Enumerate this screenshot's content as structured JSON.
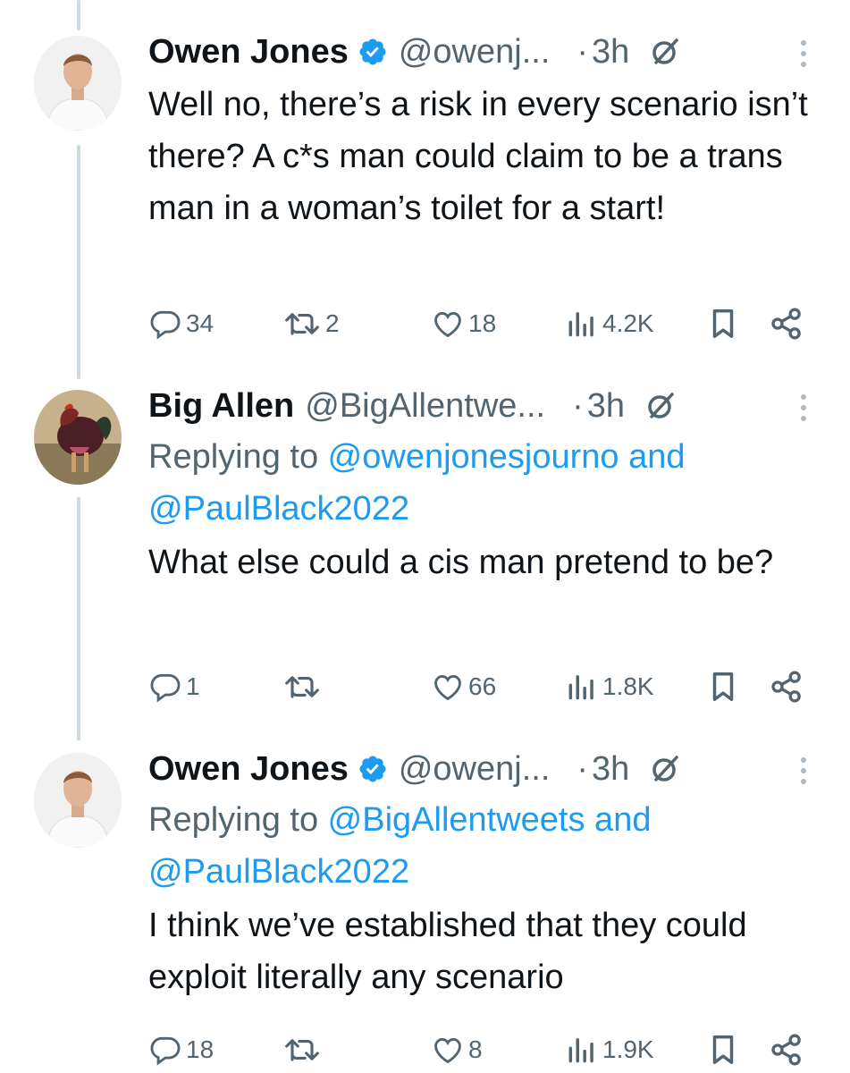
{
  "tweets": [
    {
      "author": "Owen Jones",
      "verified": true,
      "handle": "@owenj...",
      "dot": "·",
      "time": "3h",
      "reply_prefix": "",
      "reply_link1": "",
      "reply_and": "",
      "reply_link2": "",
      "text": "Well no, there’s a risk in every scenario isn’t there? A c*s man could claim to be a trans man in a woman’s toilet for a start!",
      "replies": "34",
      "retweets": "2",
      "likes": "18",
      "views": "4.2K"
    },
    {
      "author": "Big Allen",
      "verified": false,
      "handle": "@BigAllentwe...",
      "dot": "·",
      "time": "3h",
      "reply_prefix": "Replying to ",
      "reply_link1": "@owenjonesjourno",
      "reply_and": " and",
      "reply_link2": "@PaulBlack2022",
      "text": "What else could a cis man pretend to be?",
      "replies": "1",
      "retweets": "",
      "likes": "66",
      "views": "1.8K"
    },
    {
      "author": "Owen Jones",
      "verified": true,
      "handle": "@owenj...",
      "dot": "·",
      "time": "3h",
      "reply_prefix": "Replying to ",
      "reply_link1": "@BigAllentweets",
      "reply_and": " and",
      "reply_link2": "@PaulBlack2022",
      "text": "I think we’ve established that they could exploit literally any scenario",
      "replies": "18",
      "retweets": "",
      "likes": "8",
      "views": "1.9K"
    }
  ],
  "colors": {
    "text": "#0f1419",
    "secondary": "#536471",
    "link": "#1d9bf0",
    "verified": "#1d9bf0",
    "thread_line": "#cfd9de"
  },
  "icons": [
    "verified-badge-icon",
    "edit-history-icon",
    "more-options-icon",
    "reply-icon",
    "retweet-icon",
    "like-icon",
    "views-icon",
    "bookmark-icon",
    "share-icon"
  ]
}
